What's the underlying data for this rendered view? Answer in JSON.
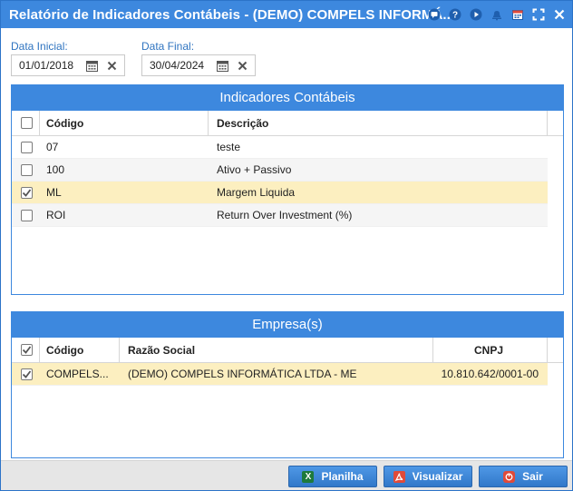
{
  "window": {
    "title": "Relatório de Indicadores Contábeis - (DEMO) COMPELS INFORMÁ...",
    "title_icons": [
      "chat-icon",
      "help-icon",
      "play-icon",
      "bell-icon",
      "calendar-icon",
      "fullscreen-icon",
      "close-icon"
    ]
  },
  "filters": {
    "start_label": "Data Inicial:",
    "start_value": "01/01/2018",
    "end_label": "Data Final:",
    "end_value": "30/04/2024"
  },
  "indicators": {
    "title": "Indicadores Contábeis",
    "columns": [
      "Código",
      "Descrição"
    ],
    "rows": [
      {
        "code": "07",
        "description": "teste",
        "checked": false
      },
      {
        "code": "100",
        "description": "Ativo + Passivo",
        "checked": false
      },
      {
        "code": "ML",
        "description": "Margem Liquida",
        "checked": true
      },
      {
        "code": "ROI",
        "description": "Return Over Investment (%)",
        "checked": false
      }
    ]
  },
  "companies": {
    "title": "Empresa(s)",
    "columns": [
      "Código",
      "Razão Social",
      "CNPJ"
    ],
    "rows": [
      {
        "code": "COMPELS...",
        "name": "(DEMO) COMPELS INFORMÁTICA LTDA - ME",
        "cnpj": "10.810.642/0001-00",
        "checked": true
      }
    ]
  },
  "footer": {
    "planilha": "Planilha",
    "visualizar": "Visualizar",
    "sair": "Sair"
  },
  "colors": {
    "primary": "#3d88de",
    "selected_row": "#fcefc0",
    "label": "#2f74c0"
  }
}
